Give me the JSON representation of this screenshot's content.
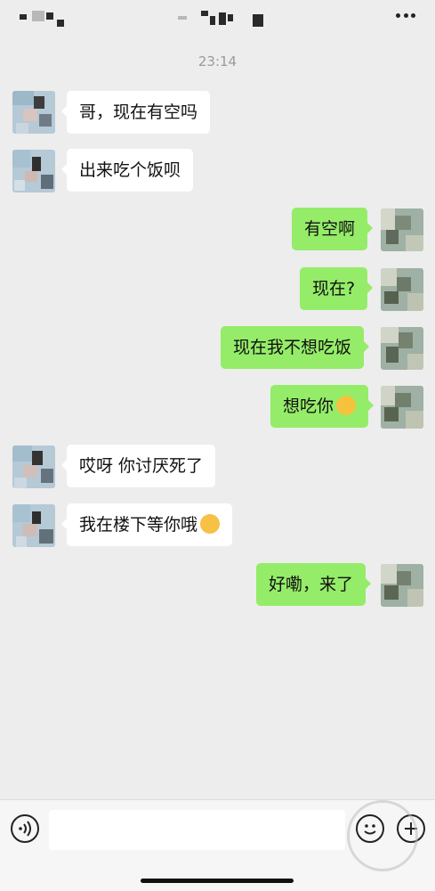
{
  "header": {
    "contact_name": "",
    "more_icon": "more-dots-icon"
  },
  "chat": {
    "timestamp": "23:14",
    "messages": [
      {
        "side": "in",
        "text": "哥，现在有空吗"
      },
      {
        "side": "in",
        "text": "出来吃个饭呗"
      },
      {
        "side": "out",
        "text": "有空啊"
      },
      {
        "side": "out",
        "text": "现在?"
      },
      {
        "side": "out",
        "text": "现在我不想吃饭"
      },
      {
        "side": "out",
        "text": "想吃你",
        "emoji": "doge-emoji"
      },
      {
        "side": "in",
        "text": "哎呀 你讨厌死了"
      },
      {
        "side": "in",
        "text": "我在楼下等你哦",
        "emoji": "blush-emoji"
      },
      {
        "side": "out",
        "text": "好嘞，来了"
      }
    ]
  },
  "input_bar": {
    "voice_icon": "voice-icon",
    "message_value": "",
    "emoji_icon": "emoji-icon",
    "add_icon": "plus-icon"
  },
  "colors": {
    "background": "#ededed",
    "incoming_bubble": "#ffffff",
    "outgoing_bubble": "#95ec69",
    "timestamp": "#9a9a9a"
  }
}
